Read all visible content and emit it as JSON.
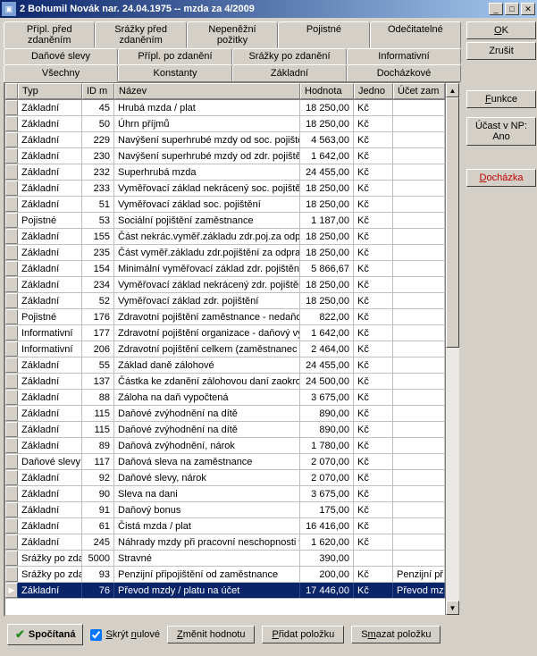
{
  "window": {
    "title": "2 Bohumil Novák nar. 24.04.1975 -- mzda za 4/2009"
  },
  "tabs": {
    "row1": [
      "Přípl. před zdaněním",
      "Srážky před zdaněním",
      "Nepeněžní požitky",
      "Pojistné",
      "Odečitatelné"
    ],
    "row2": [
      "Daňové slevy",
      "Přípl. po zdanění",
      "Srážky po zdanění",
      "Informativní"
    ],
    "row3": [
      "Všechny",
      "Konstanty",
      "Základní",
      "Docházkové"
    ]
  },
  "grid": {
    "headers": [
      "",
      "Typ",
      "ID m",
      "Název",
      "Hodnota",
      "Jedno",
      "Účet zam"
    ],
    "rows": [
      {
        "typ": "Základní",
        "id": "45",
        "nazev": "Hrubá mzda / plat",
        "hodnota": "18 250,00",
        "jed": "Kč",
        "ucet": ""
      },
      {
        "typ": "Základní",
        "id": "50",
        "nazev": "Úhrn příjmů",
        "hodnota": "18 250,00",
        "jed": "Kč",
        "ucet": ""
      },
      {
        "typ": "Základní",
        "id": "229",
        "nazev": "Navýšení superhrubé mzdy od soc. pojištěn",
        "hodnota": "4 563,00",
        "jed": "Kč",
        "ucet": ""
      },
      {
        "typ": "Základní",
        "id": "230",
        "nazev": "Navýšení superhrubé mzdy od zdr. pojištěn",
        "hodnota": "1 642,00",
        "jed": "Kč",
        "ucet": ""
      },
      {
        "typ": "Základní",
        "id": "232",
        "nazev": "Superhrubá mzda",
        "hodnota": "24 455,00",
        "jed": "Kč",
        "ucet": ""
      },
      {
        "typ": "Základní",
        "id": "233",
        "nazev": "Vyměřovací základ nekrácený soc. pojištěn",
        "hodnota": "18 250,00",
        "jed": "Kč",
        "ucet": ""
      },
      {
        "typ": "Základní",
        "id": "51",
        "nazev": "Vyměřovací základ soc. pojištění",
        "hodnota": "18 250,00",
        "jed": "Kč",
        "ucet": ""
      },
      {
        "typ": "Pojistné",
        "id": "53",
        "nazev": "Sociální pojištění zaměstnance",
        "hodnota": "1 187,00",
        "jed": "Kč",
        "ucet": ""
      },
      {
        "typ": "Základní",
        "id": "155",
        "nazev": "Část nekrác.vyměř.základu zdr.poj.za odpra",
        "hodnota": "18 250,00",
        "jed": "Kč",
        "ucet": ""
      },
      {
        "typ": "Základní",
        "id": "235",
        "nazev": "Část vyměř.základu zdr.pojištění za odprac.",
        "hodnota": "18 250,00",
        "jed": "Kč",
        "ucet": ""
      },
      {
        "typ": "Základní",
        "id": "154",
        "nazev": "Minimální vyměřovací základ zdr. pojištění",
        "hodnota": "5 866,67",
        "jed": "Kč",
        "ucet": ""
      },
      {
        "typ": "Základní",
        "id": "234",
        "nazev": "Vyměřovací základ nekrácený zdr. pojištění",
        "hodnota": "18 250,00",
        "jed": "Kč",
        "ucet": ""
      },
      {
        "typ": "Základní",
        "id": "52",
        "nazev": "Vyměřovací základ zdr. pojištění",
        "hodnota": "18 250,00",
        "jed": "Kč",
        "ucet": ""
      },
      {
        "typ": "Pojistné",
        "id": "176",
        "nazev": "Zdravotní pojištění zaměstnance - nedaňov",
        "hodnota": "822,00",
        "jed": "Kč",
        "ucet": ""
      },
      {
        "typ": "Informativní",
        "id": "177",
        "nazev": "Zdravotní pojištění organizace - daňový výd",
        "hodnota": "1 642,00",
        "jed": "Kč",
        "ucet": ""
      },
      {
        "typ": "Informativní",
        "id": "206",
        "nazev": "Zdravotní pojištění celkem (zaměstnanec +",
        "hodnota": "2 464,00",
        "jed": "Kč",
        "ucet": ""
      },
      {
        "typ": "Základní",
        "id": "55",
        "nazev": "Základ daně zálohové",
        "hodnota": "24 455,00",
        "jed": "Kč",
        "ucet": ""
      },
      {
        "typ": "Základní",
        "id": "137",
        "nazev": "Částka ke zdanění zálohovou daní zaokrou",
        "hodnota": "24 500,00",
        "jed": "Kč",
        "ucet": ""
      },
      {
        "typ": "Základní",
        "id": "88",
        "nazev": "Záloha na daň vypočtená",
        "hodnota": "3 675,00",
        "jed": "Kč",
        "ucet": ""
      },
      {
        "typ": "Základní",
        "id": "115",
        "nazev": "Daňové zvýhodnění na dítě",
        "hodnota": "890,00",
        "jed": "Kč",
        "ucet": ""
      },
      {
        "typ": "Základní",
        "id": "115",
        "nazev": "Daňové zvýhodnění na dítě",
        "hodnota": "890,00",
        "jed": "Kč",
        "ucet": ""
      },
      {
        "typ": "Základní",
        "id": "89",
        "nazev": "Daňová zvýhodnění, nárok",
        "hodnota": "1 780,00",
        "jed": "Kč",
        "ucet": ""
      },
      {
        "typ": "Daňové slevy",
        "id": "117",
        "nazev": "Daňová sleva na zaměstnance",
        "hodnota": "2 070,00",
        "jed": "Kč",
        "ucet": ""
      },
      {
        "typ": "Základní",
        "id": "92",
        "nazev": "Daňové slevy, nárok",
        "hodnota": "2 070,00",
        "jed": "Kč",
        "ucet": ""
      },
      {
        "typ": "Základní",
        "id": "90",
        "nazev": "Sleva na dani",
        "hodnota": "3 675,00",
        "jed": "Kč",
        "ucet": ""
      },
      {
        "typ": "Základní",
        "id": "91",
        "nazev": "Daňový bonus",
        "hodnota": "175,00",
        "jed": "Kč",
        "ucet": ""
      },
      {
        "typ": "Základní",
        "id": "61",
        "nazev": "Čistá mzda / plat",
        "hodnota": "16 416,00",
        "jed": "Kč",
        "ucet": ""
      },
      {
        "typ": "Základní",
        "id": "245",
        "nazev": "Náhrady mzdy při pracovní neschopnosti v",
        "hodnota": "1 620,00",
        "jed": "Kč",
        "ucet": ""
      },
      {
        "typ": "Srážky po zdan",
        "id": "5000",
        "nazev": "Stravné",
        "hodnota": "390,00",
        "jed": "",
        "ucet": ""
      },
      {
        "typ": "Srážky po zdan",
        "id": "93",
        "nazev": "Penzijní připojištění od zaměstnance",
        "hodnota": "200,00",
        "jed": "Kč",
        "ucet": "Penzijní př"
      },
      {
        "typ": "Základní",
        "id": "76",
        "nazev": "Převod mzdy / platu na účet",
        "hodnota": "17 446,00",
        "jed": "Kč",
        "ucet": "Převod mz",
        "sel": true,
        "mark": "▶"
      }
    ]
  },
  "bottom": {
    "status": "Spočítaná",
    "hide_zero": "Skrýt nulové",
    "change_value": "Změnit hodnotu",
    "add_item": "Přidat položku",
    "delete_item": "Smazat položku"
  },
  "side": {
    "ok": "OK",
    "cancel": "Zrušit",
    "functions": "Funkce",
    "np": "Účast v NP: Ano",
    "attendance": "Docházka"
  }
}
